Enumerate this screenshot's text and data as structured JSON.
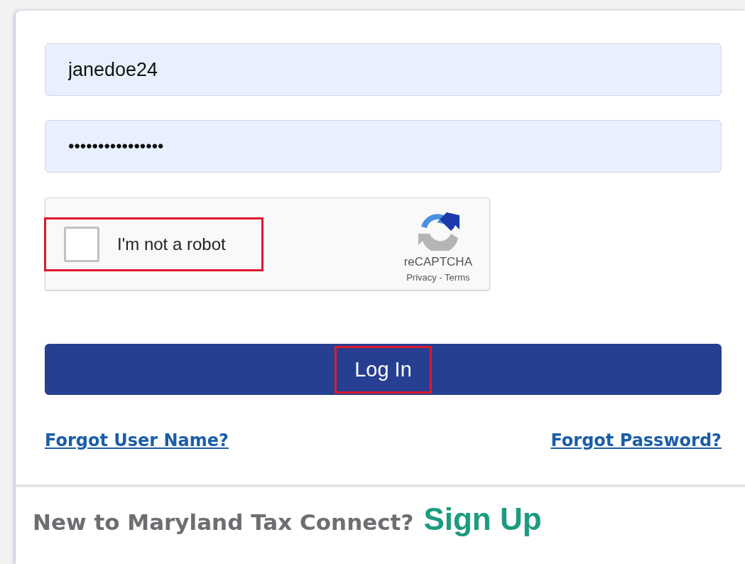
{
  "username": {
    "value": "janedoe24"
  },
  "password": {
    "value": "••••••••••••••••"
  },
  "captcha": {
    "label": "I'm not a robot",
    "checked": false,
    "highlighted": true,
    "brand": "reCAPTCHA",
    "legal": "Privacy - Terms"
  },
  "login_button": {
    "label": "Log In",
    "highlighted": true
  },
  "links": [
    "Forgot User Name?",
    "Forgot Password?"
  ],
  "footer": {
    "text": "New to Maryland Tax Connect?",
    "link": "Sign Up"
  }
}
